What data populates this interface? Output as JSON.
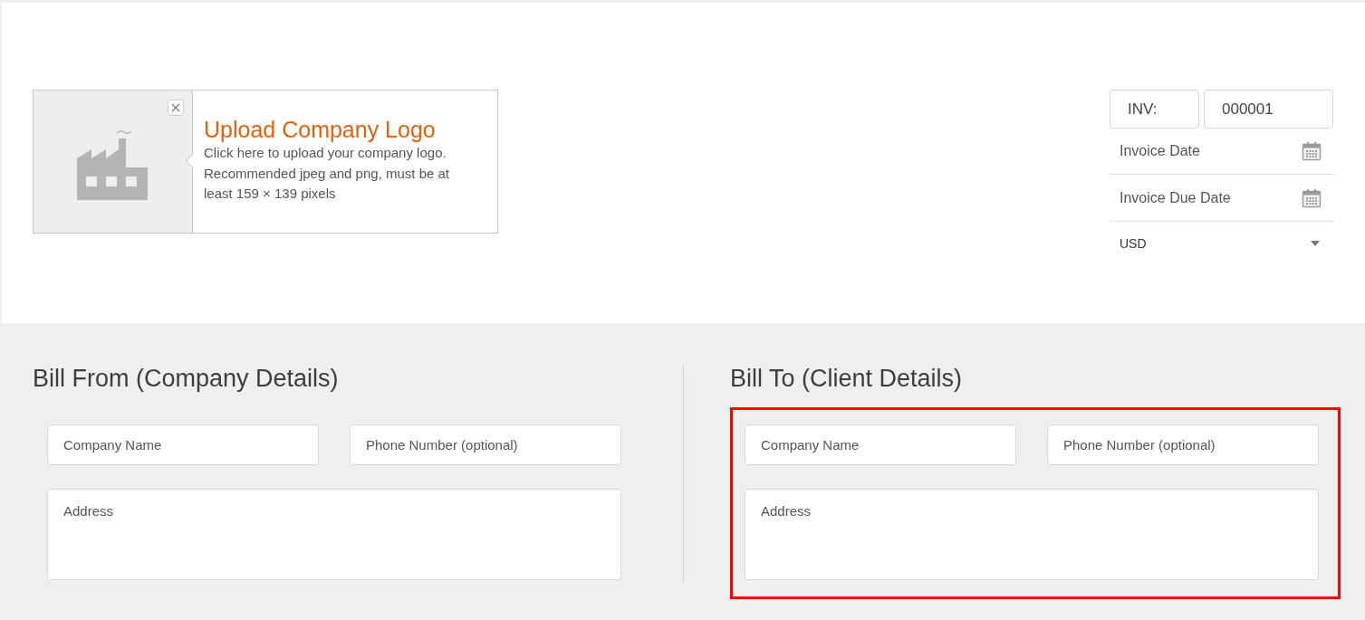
{
  "logo_upload": {
    "title": "Upload Company Logo",
    "description": "Click here to upload your company logo. Recommended jpeg and png, must be at least 159 × 139 pixels"
  },
  "invoice_meta": {
    "prefix": "INV:",
    "number": "000001",
    "date": {
      "placeholder": "Invoice Date"
    },
    "due_date": {
      "placeholder": "Invoice Due Date"
    },
    "currency": "USD"
  },
  "sections": [
    {
      "title": "Bill From (Company Details)",
      "highlighted": false,
      "company_name": {
        "placeholder": "Company Name"
      },
      "phone": {
        "placeholder": "Phone Number (optional)"
      },
      "address": {
        "placeholder": "Address"
      }
    },
    {
      "title": "Bill To (Client Details)",
      "highlighted": true,
      "company_name": {
        "placeholder": "Company Name"
      },
      "phone": {
        "placeholder": "Phone Number (optional)"
      },
      "address": {
        "placeholder": "Address"
      }
    }
  ]
}
